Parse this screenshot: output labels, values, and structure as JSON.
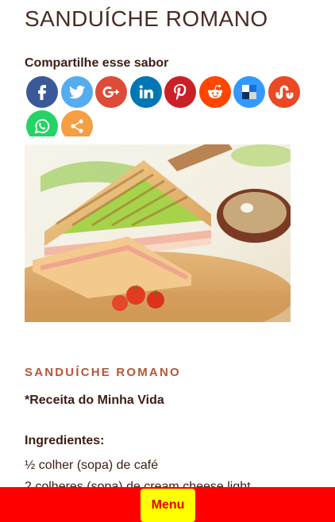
{
  "page": {
    "title": "SANDUÍCHE ROMANO"
  },
  "share": {
    "heading": "Compartilhe esse sabor",
    "buttons": [
      {
        "name": "facebook",
        "icon": "facebook-icon",
        "color": "#3b5998"
      },
      {
        "name": "twitter",
        "icon": "twitter-icon",
        "color": "#55acee"
      },
      {
        "name": "google-plus",
        "icon": "google-plus-icon",
        "color": "#dd4b39"
      },
      {
        "name": "linkedin",
        "icon": "linkedin-icon",
        "color": "#0077b5"
      },
      {
        "name": "pinterest",
        "icon": "pinterest-icon",
        "color": "#cb2027"
      },
      {
        "name": "reddit",
        "icon": "reddit-icon",
        "color": "#ff4500"
      },
      {
        "name": "delicious",
        "icon": "delicious-icon",
        "color": "#3399ff"
      },
      {
        "name": "stumbleupon",
        "icon": "stumbleupon-icon",
        "color": "#eb4823"
      },
      {
        "name": "whatsapp",
        "icon": "whatsapp-icon",
        "color": "#25d366"
      },
      {
        "name": "more",
        "icon": "share-more-icon",
        "color": "#f59e42"
      }
    ]
  },
  "recipe": {
    "heading": "SANDUÍCHE ROMANO",
    "credit": "*Receita do Minha Vida",
    "ingredients_title": "Ingredientes:",
    "ingredients": [
      "½ colher (sopa) de café",
      "2 colheres (sopa) de cream cheese light"
    ]
  },
  "menu": {
    "label": "Menu"
  },
  "colors": {
    "menu_bar": "#ff0000",
    "menu_button": "#ffff00",
    "accent": "#b5563a"
  }
}
